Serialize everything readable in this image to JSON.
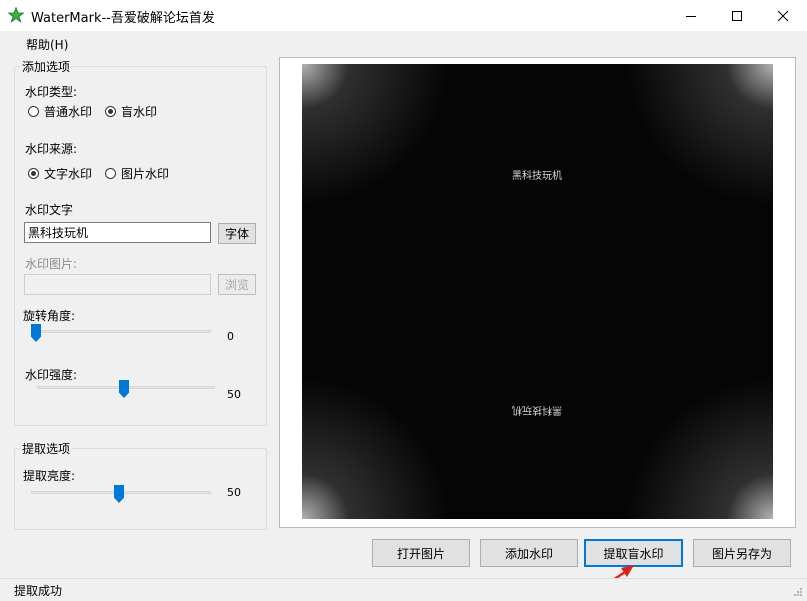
{
  "window": {
    "title": "WaterMark--吾爱破解论坛首发",
    "icon": "green-star-icon",
    "controls": [
      "minimize-icon",
      "maximize-icon",
      "close-icon"
    ]
  },
  "menu": {
    "help": "帮助(H)"
  },
  "add_options": {
    "title": "添加选项",
    "watermark_type": {
      "label": "水印类型:",
      "options": [
        "普通水印",
        "盲水印"
      ],
      "selected": "盲水印"
    },
    "watermark_source": {
      "label": "水印来源:",
      "options": [
        "文字水印",
        "图片水印"
      ],
      "selected": "文字水印"
    },
    "watermark_text": {
      "label": "水印文字",
      "value": "黑科技玩机",
      "font_button": "字体"
    },
    "watermark_image": {
      "label": "水印图片:",
      "value": "",
      "browse_button": "浏览"
    },
    "rotation": {
      "label": "旋转角度:",
      "value": "0",
      "fraction": 0.0
    },
    "strength": {
      "label": "水印强度:",
      "value": "50",
      "fraction": 0.5
    }
  },
  "extract_options": {
    "title": "提取选项",
    "brightness": {
      "label": "提取亮度:",
      "value": "50",
      "fraction": 0.5
    }
  },
  "preview": {
    "watermark_text": "黑科技玩机",
    "watermark_text_mirrored": "黑科技玩机"
  },
  "actions": {
    "open": "打开图片",
    "add": "添加水印",
    "extract": "提取盲水印",
    "save_as": "图片另存为"
  },
  "status": {
    "text": "提取成功"
  },
  "colors": {
    "accent": "#0078d7",
    "arrow": "#e02020"
  }
}
